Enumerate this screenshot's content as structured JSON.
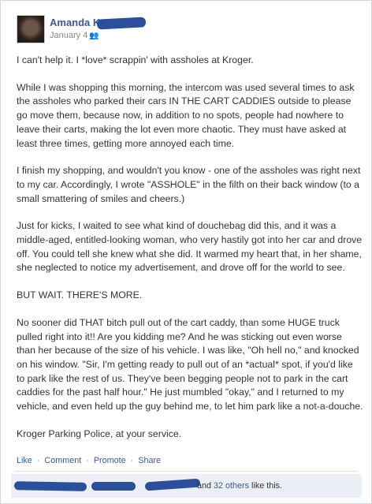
{
  "post": {
    "author": "Amanda K",
    "date": "January 4",
    "paragraphs": [
      "I can't help it. I *love* scrappin' with assholes at Kroger.",
      "While I was shopping this morning, the intercom was used several times to ask the assholes who parked their cars IN THE CART CADDIES outside to please go move them, because now, in addition to no spots, people had nowhere to leave their carts, making the lot even more chaotic. They must have asked at least three times, getting more annoyed each time.",
      "I finish my shopping, and wouldn't you know - one of the assholes was right next to my car. Accordingly, I wrote \"ASSHOLE\" in the filth on their back window (to a small smattering of smiles and cheers.)",
      "Just for kicks, I waited to see what kind of douchebag did this, and it was a middle-aged, entitled-looking woman, who very hastily got into her car and drove off. You could tell she knew what she did. It warmed my heart that, in her shame, she neglected to notice my advertisement, and drove off for the world to see.",
      "BUT WAIT. THERE'S MORE.",
      "No sooner did THAT bitch pull out of the cart caddy, than some HUGE truck pulled right into it!! Are you kidding me? And he was sticking out even worse than her because of the size of his vehicle. I was like, \"Oh hell no,\" and knocked on his window. \"Sir, I'm getting ready to pull out of an *actual* spot, if you'd like to park like the rest of us. They've been begging people not to park in the cart caddies for the past half hour.\" He just mumbled \"okay,\" and I returned to my vehicle, and even held up the guy behind me, to let him park like a not-a-douche.",
      "Kroger Parking Police, at your service."
    ]
  },
  "actions": {
    "like": "Like",
    "comment": "Comment",
    "promote": "Promote",
    "share": "Share",
    "separator": "·"
  },
  "likes": {
    "conjunction": "and",
    "others": "32 others",
    "suffix": "like this."
  },
  "icons": {
    "audience": "friends-icon"
  },
  "colors": {
    "link": "#3b5998",
    "redaction": "#2b4f9a",
    "likes_background": "#eceff5"
  }
}
